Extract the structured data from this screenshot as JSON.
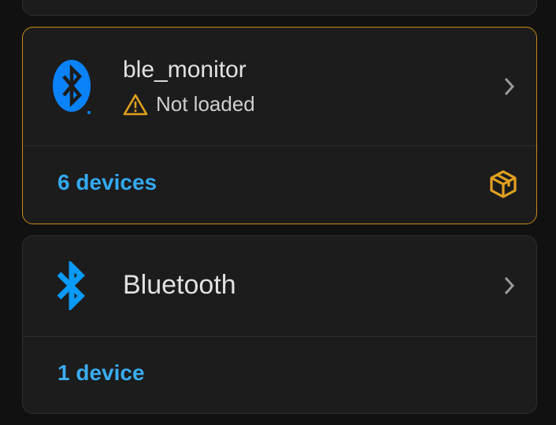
{
  "colors": {
    "background": "#111111",
    "card": "#1c1c1c",
    "warning": "#e0a020",
    "link": "#34a9f0",
    "bluetooth_blue": "#0a82fa"
  },
  "cards": [
    {
      "title": "ble_monitor",
      "status_icon": "warning-triangle-icon",
      "status_text": "Not loaded",
      "logo_icon": "bluetooth-logo-icon",
      "devices_link": "6 devices",
      "footer_icon": "custom-integration-package-icon"
    },
    {
      "title": "Bluetooth",
      "logo_icon": "bluetooth-icon",
      "devices_link": "1 device"
    }
  ]
}
